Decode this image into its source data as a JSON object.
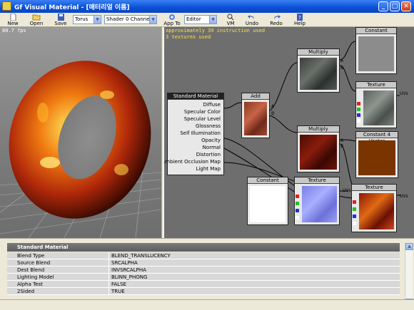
{
  "window": {
    "title": "Gf Visual Material - [매터리얼 이름]",
    "min": "_",
    "max": "□",
    "close": "✕"
  },
  "toolbar": {
    "new_label": "New",
    "open_label": "Open",
    "save_label": "Save",
    "mesh_select": "Torus",
    "channel_select": "Shader 0 Channel",
    "app_to_label": "App To",
    "editor_select": "Editor",
    "vm_origin_label": "VM Origin",
    "undo_label": "Undo",
    "redo_label": "Redo",
    "help_label": "Help"
  },
  "viewport": {
    "fps": "80.7 fps"
  },
  "graph": {
    "info_line1": "approximately 39 instruction used",
    "info_line2": "3 textures used",
    "nodes": {
      "standard_material": {
        "title": "Standard Material",
        "inputs": [
          "Diffuse",
          "Specular Color",
          "Specular Level",
          "Glossness",
          "Self Illumination",
          "Opacity",
          "Normal",
          "Distortion",
          "Ambient Occlusion Map",
          "Light Map"
        ]
      },
      "add": {
        "title": "Add",
        "port_a": "A",
        "port_b": "B"
      },
      "multiply_top": {
        "title": "Multiply",
        "port_a": "A",
        "port_b": "B"
      },
      "multiply_mid": {
        "title": "Multiply",
        "port_a": "A",
        "port_b": "B"
      },
      "constant_top": {
        "title": "Constant"
      },
      "texture_top": {
        "title": "Texture",
        "uvs": "UVs"
      },
      "constant4": {
        "title": "Constant 4 Vector"
      },
      "constant_bottom": {
        "title": "Constant"
      },
      "texture_normal": {
        "title": "Texture",
        "uvs": "UVs"
      },
      "texture_lava": {
        "title": "Texture",
        "uvs": "UVs"
      }
    }
  },
  "properties": {
    "title": "Standard Material",
    "rows": [
      {
        "key": "Blend Type",
        "value": "BLEND_TRANSLUCENCY"
      },
      {
        "key": "Source Blend",
        "value": "SRCALPHA"
      },
      {
        "key": "Dest Blend",
        "value": "INVSRCALPHA"
      },
      {
        "key": "Lighting Model",
        "value": "BLINN_PHONG"
      },
      {
        "key": "Alpha Test",
        "value": "FALSE"
      },
      {
        "key": "2Sided",
        "value": "TRUE"
      }
    ]
  },
  "colors": {
    "titlebar": "#0a4fd6",
    "graph_bg": "#6e6e6e",
    "lava": "#c8380c",
    "constant4": "#7a3400"
  }
}
